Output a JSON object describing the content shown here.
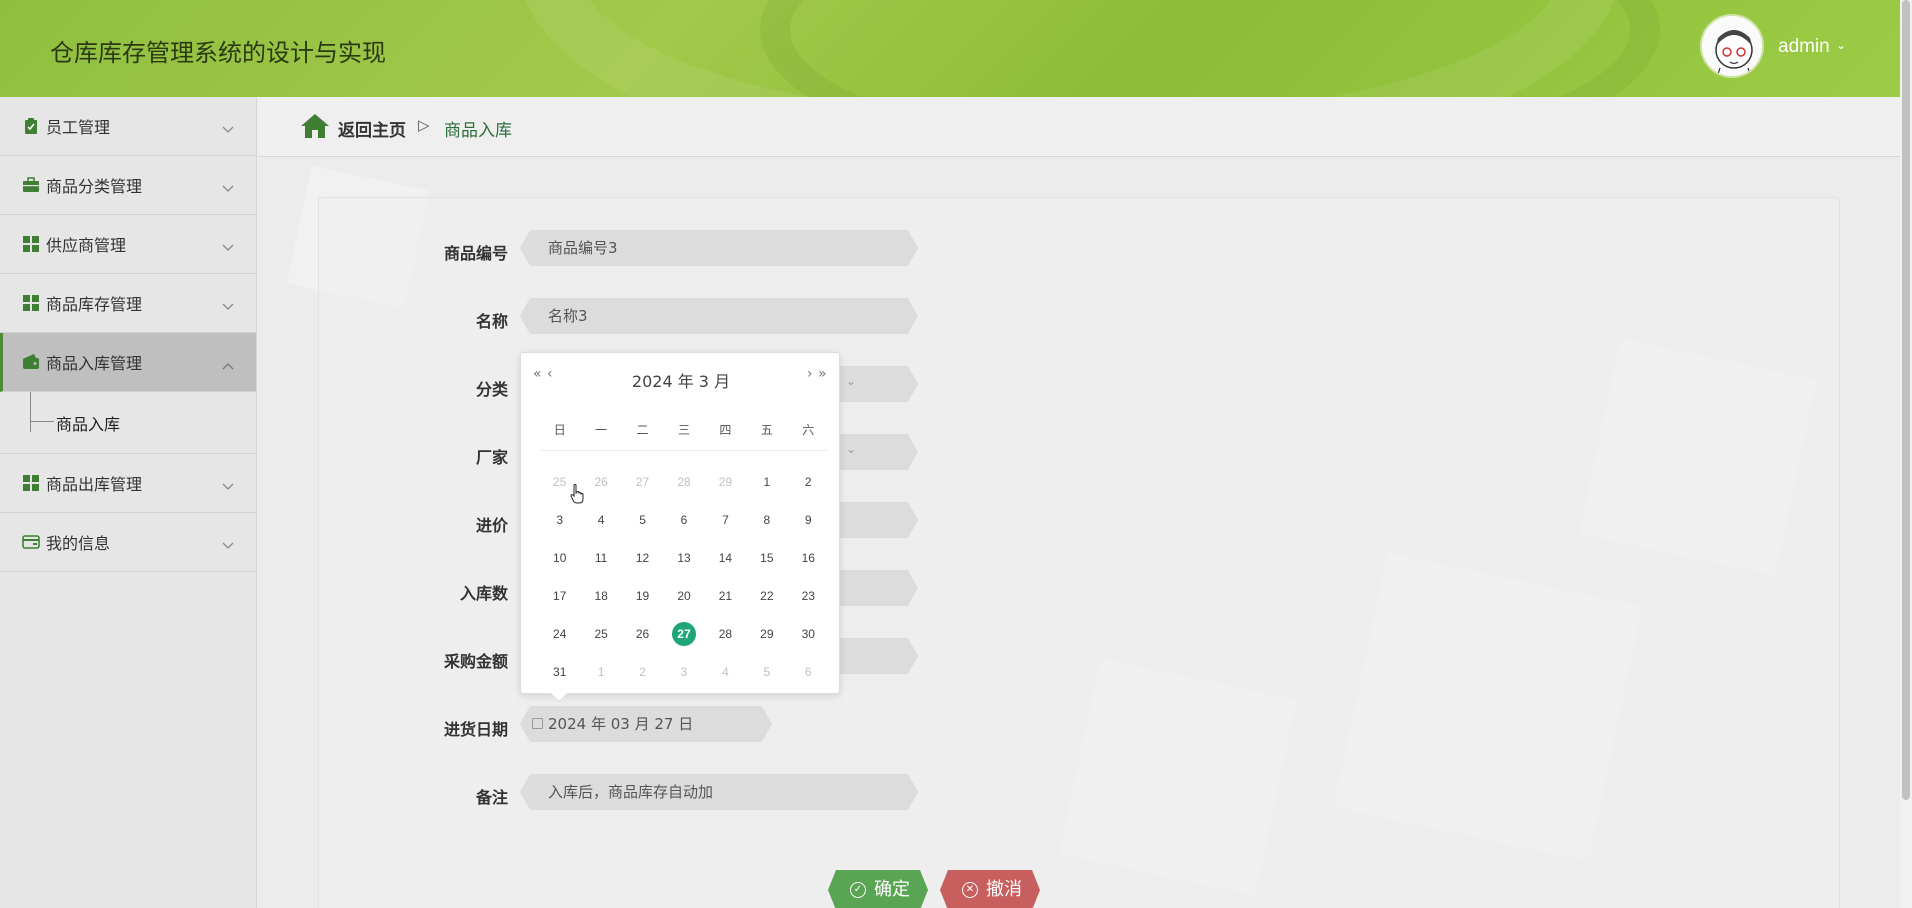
{
  "header": {
    "title": "仓库库存管理系统的设计与实现",
    "user": "admin",
    "user_caret": "⌄"
  },
  "sidebar": {
    "items": [
      {
        "label": "员工管理",
        "icon": "clipboard-icon",
        "caret": "⌄"
      },
      {
        "label": "商品分类管理",
        "icon": "briefcase-icon",
        "caret": "⌄"
      },
      {
        "label": "供应商管理",
        "icon": "grid-icon",
        "caret": "⌄"
      },
      {
        "label": "商品库存管理",
        "icon": "grid-icon",
        "caret": "⌄"
      },
      {
        "label": "商品入库管理",
        "icon": "wallet-icon",
        "caret": "⌃",
        "expanded": true,
        "children": [
          {
            "label": "商品入库"
          }
        ]
      },
      {
        "label": "商品出库管理",
        "icon": "grid-icon",
        "caret": "⌄"
      },
      {
        "label": "我的信息",
        "icon": "card-icon",
        "caret": "⌄"
      }
    ]
  },
  "breadcrumb": {
    "home": "返回主页",
    "separator": "▷",
    "current": "商品入库"
  },
  "form": {
    "code_label": "商品编号",
    "code_value": "商品编号3",
    "name_label": "名称",
    "name_value": "名称3",
    "category_label": "分类",
    "vendor_label": "厂家",
    "price_label": "进价",
    "qty_label": "入库数",
    "amount_label": "采购金额",
    "date_label": "进货日期",
    "date_value": "2024 年 03 月 27 日",
    "note_label": "备注",
    "note_value": "入库后，商品库存自动加",
    "select_caret": "⌄"
  },
  "calendar": {
    "prev_year": "«",
    "prev_month": "‹",
    "next_month": "›",
    "next_year": "»",
    "title": "2024 年  3 月",
    "weekdays": [
      "日",
      "一",
      "二",
      "三",
      "四",
      "五",
      "六"
    ],
    "weeks": [
      [
        "25",
        "26",
        "27",
        "28",
        "29",
        "1",
        "2"
      ],
      [
        "3",
        "4",
        "5",
        "6",
        "7",
        "8",
        "9"
      ],
      [
        "10",
        "11",
        "12",
        "13",
        "14",
        "15",
        "16"
      ],
      [
        "17",
        "18",
        "19",
        "20",
        "21",
        "22",
        "23"
      ],
      [
        "24",
        "25",
        "26",
        "27",
        "28",
        "29",
        "30"
      ],
      [
        "31",
        "1",
        "2",
        "3",
        "4",
        "5",
        "6"
      ]
    ],
    "selected": "27"
  },
  "buttons": {
    "confirm": "确定",
    "cancel": "撤消"
  },
  "colors": {
    "header": "#9cc747",
    "primary": "#5aa554",
    "danger": "#c85f5f",
    "selected_day": "#1ea67a"
  }
}
